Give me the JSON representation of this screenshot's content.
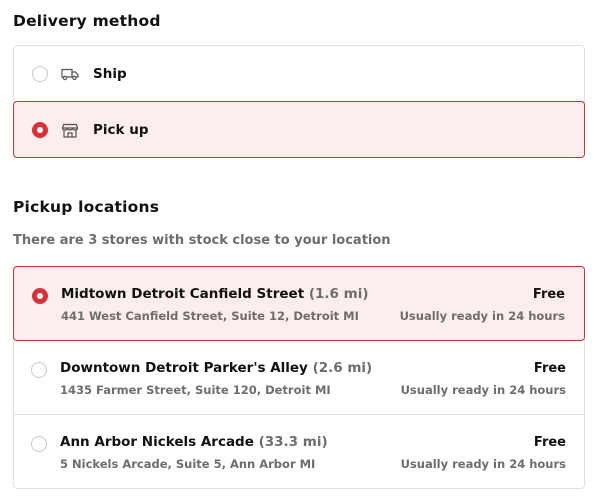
{
  "delivery": {
    "title": "Delivery method",
    "options": [
      {
        "label": "Ship",
        "icon": "truck-icon",
        "selected": false
      },
      {
        "label": "Pick up",
        "icon": "store-icon",
        "selected": true
      }
    ]
  },
  "pickup": {
    "title": "Pickup locations",
    "subtitle": "There are 3 stores with stock close to your location",
    "locations": [
      {
        "name": "Midtown Detroit Canfield Street",
        "distance": "(1.6 mi)",
        "address": "441 West Canfield Street, Suite 12, Detroit MI",
        "price": "Free",
        "ready": "Usually ready in 24 hours",
        "selected": true
      },
      {
        "name": "Downtown Detroit Parker's Alley",
        "distance": "(2.6 mi)",
        "address": "1435 Farmer Street, Suite 120, Detroit MI",
        "price": "Free",
        "ready": "Usually ready in 24 hours",
        "selected": false
      },
      {
        "name": "Ann Arbor Nickels Arcade",
        "distance": "(33.3 mi)",
        "address": "5 Nickels Arcade, Suite 5, Ann Arbor MI",
        "price": "Free",
        "ready": "Usually ready in 24 hours",
        "selected": false
      }
    ]
  },
  "colors": {
    "accent": "#d7323a",
    "selected_bg": "#fdeeee",
    "muted_text": "#6d6d6d",
    "border": "#e0e0e0"
  }
}
